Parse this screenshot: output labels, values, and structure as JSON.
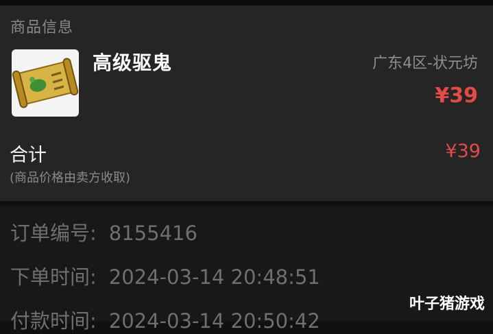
{
  "product_section": {
    "title": "商品信息",
    "item_name": "高级驱鬼",
    "server": "广东4区-状元坊",
    "unit_price": "¥39",
    "total_label": "合计",
    "total_price": "¥39",
    "note": "(商品价格由卖方收取)"
  },
  "order_section": {
    "order_number_label": "订单编号:",
    "order_number": "8155416",
    "order_time_label": "下单时间:",
    "order_time": "2024-03-14 20:48:51",
    "payment_time_label": "付款时间:",
    "payment_time": "2024-03-14 20:50:42"
  },
  "watermark": "叶子猪游戏",
  "colors": {
    "price": "#e34a4a",
    "card_bg": "#252525"
  },
  "icons": {
    "item_image": "scroll-icon"
  }
}
